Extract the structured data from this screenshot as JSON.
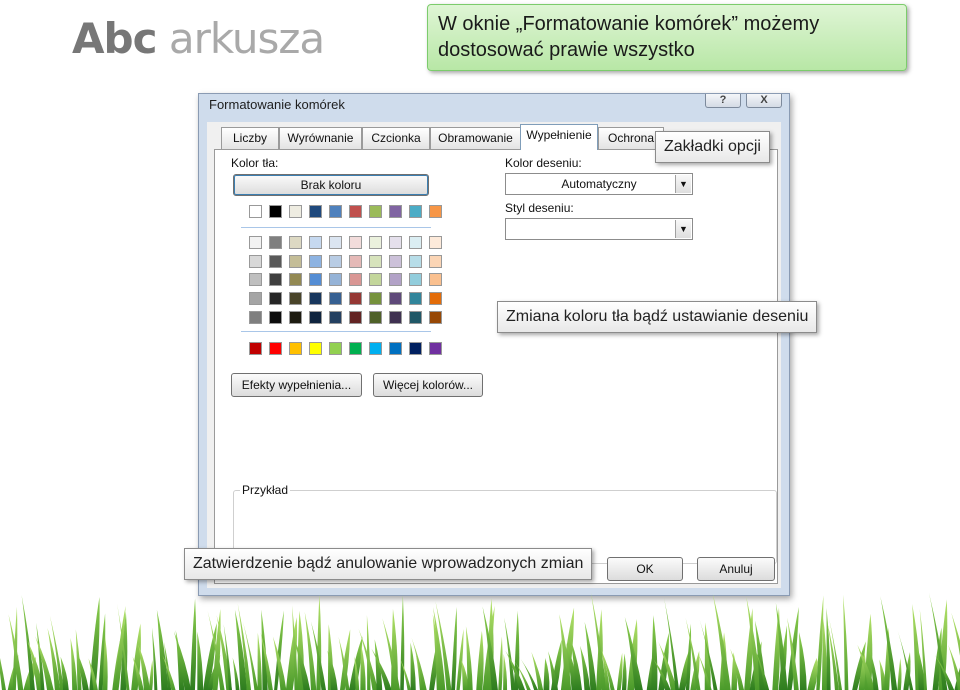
{
  "slide": {
    "title_bold": "Abc",
    "title_light": "arkusza",
    "green_callout": "W oknie „Formatowanie komórek” możemy dostosować prawie wszystko",
    "callout_tabs": "Zakładki opcji",
    "callout_color": "Zmiana koloru tła bądź ustawianie deseniu",
    "callout_confirm": "Zatwierdzenie bądź anulowanie wprowadzonych zmian"
  },
  "dialog": {
    "title": "Formatowanie komórek",
    "help_button": "?",
    "close_button": "X",
    "tabs": [
      "Liczby",
      "Wyrównanie",
      "Czcionka",
      "Obramowanie",
      "Wypełnienie",
      "Ochrona"
    ],
    "active_tab": "Wypełnienie",
    "background_color_label": "Kolor tła:",
    "no_color_button": "Brak koloru",
    "fill_effects_button": "Efekty wypełnienia...",
    "more_colors_button": "Więcej kolorów...",
    "pattern_color_label": "Kolor deseniu:",
    "pattern_color_value": "Automatyczny",
    "pattern_style_label": "Styl deseniu:",
    "pattern_style_value": "",
    "sample_label": "Przykład",
    "ok_button": "OK",
    "cancel_button": "Anuluj"
  },
  "palette": {
    "theme_top": [
      "#ffffff",
      "#000000",
      "#eeece1",
      "#1f497d",
      "#4f81bd",
      "#c0504d",
      "#9bbb59",
      "#8064a2",
      "#4bacc6",
      "#f79646"
    ],
    "theme_shades": [
      [
        "#f2f2f2",
        "#7f7f7f",
        "#ddd9c3",
        "#c6d9f0",
        "#dbe5f1",
        "#f2dcdb",
        "#ebf1dd",
        "#e5e0ec",
        "#dbeef3",
        "#fdeada"
      ],
      [
        "#d8d8d8",
        "#595959",
        "#c4bd97",
        "#8db3e2",
        "#b8cce4",
        "#e5b9b7",
        "#d7e3bc",
        "#ccc1d9",
        "#b7dde8",
        "#fbd5b5"
      ],
      [
        "#bfbfbf",
        "#3f3f3f",
        "#938953",
        "#548dd4",
        "#95b3d7",
        "#d99694",
        "#c3d69b",
        "#b2a2c7",
        "#92cddc",
        "#fac08f"
      ],
      [
        "#a5a5a5",
        "#262626",
        "#494429",
        "#17365d",
        "#366092",
        "#953734",
        "#76923c",
        "#5f497a",
        "#31859b",
        "#e36c09"
      ],
      [
        "#7f7f7f",
        "#0c0c0c",
        "#1d1b10",
        "#0f243e",
        "#244061",
        "#632423",
        "#4f6128",
        "#3f3151",
        "#205867",
        "#974806"
      ]
    ],
    "standard": [
      "#c00000",
      "#ff0000",
      "#ffc000",
      "#ffff00",
      "#92d050",
      "#00b050",
      "#00b0f0",
      "#0070c0",
      "#002060",
      "#7030a0"
    ]
  }
}
